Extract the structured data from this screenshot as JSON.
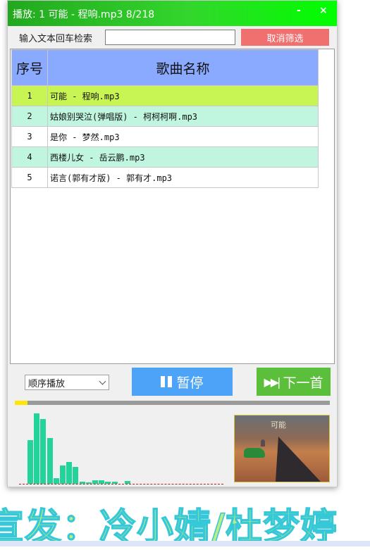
{
  "window": {
    "title": "播放: 1 可能 - 程响.mp3  8/218",
    "minimize": "-",
    "close": "×"
  },
  "search": {
    "label": "输入文本回车检索",
    "value": "",
    "placeholder": "",
    "cancel_label": "取消筛选"
  },
  "table": {
    "headers": [
      "序号",
      "歌曲名称"
    ],
    "rows": [
      {
        "index": "1",
        "name": "可能 - 程响.mp3"
      },
      {
        "index": "2",
        "name": "姑娘别哭泣(弹唱版) - 柯柯柯啊.mp3"
      },
      {
        "index": "3",
        "name": "是你 - 梦然.mp3"
      },
      {
        "index": "4",
        "name": "西楼儿女 - 岳云鹏.mp3"
      },
      {
        "index": "5",
        "name": "诺言(郭有才版) - 郭有才.mp3"
      }
    ]
  },
  "controls": {
    "mode": "顺序播放",
    "pause_label": "暂停",
    "next_label": "下一首"
  },
  "progress": {
    "fraction": 0.04
  },
  "visualizer": {
    "levels": [
      0.62,
      1.0,
      0.92,
      0.65,
      0.08,
      0.26,
      0.31,
      0.24,
      0.03,
      0.01,
      0.05,
      0.05,
      0.03,
      0.03,
      0.0,
      0.04,
      0,
      0,
      0,
      0,
      0,
      0,
      0,
      0,
      0,
      0,
      0,
      0,
      0,
      0
    ]
  },
  "album_art": {
    "title": "可能"
  },
  "watermark": "宣发：冷小婧/杜梦婷",
  "colors": {
    "title_bar": "#33d62c",
    "playing_row": "#c8f553",
    "alt_row": "#c0f5e0",
    "header": "#8aaaff",
    "pause_button": "#4da3f7",
    "next_button": "#5cbf3c",
    "cancel_button": "#f07070",
    "visualizer_bar": "#22d499",
    "progress": "#ffe600"
  },
  "icons": {
    "pause": "pause-icon",
    "next": "skip-next-icon",
    "dropdown": "chevron-down-icon"
  }
}
